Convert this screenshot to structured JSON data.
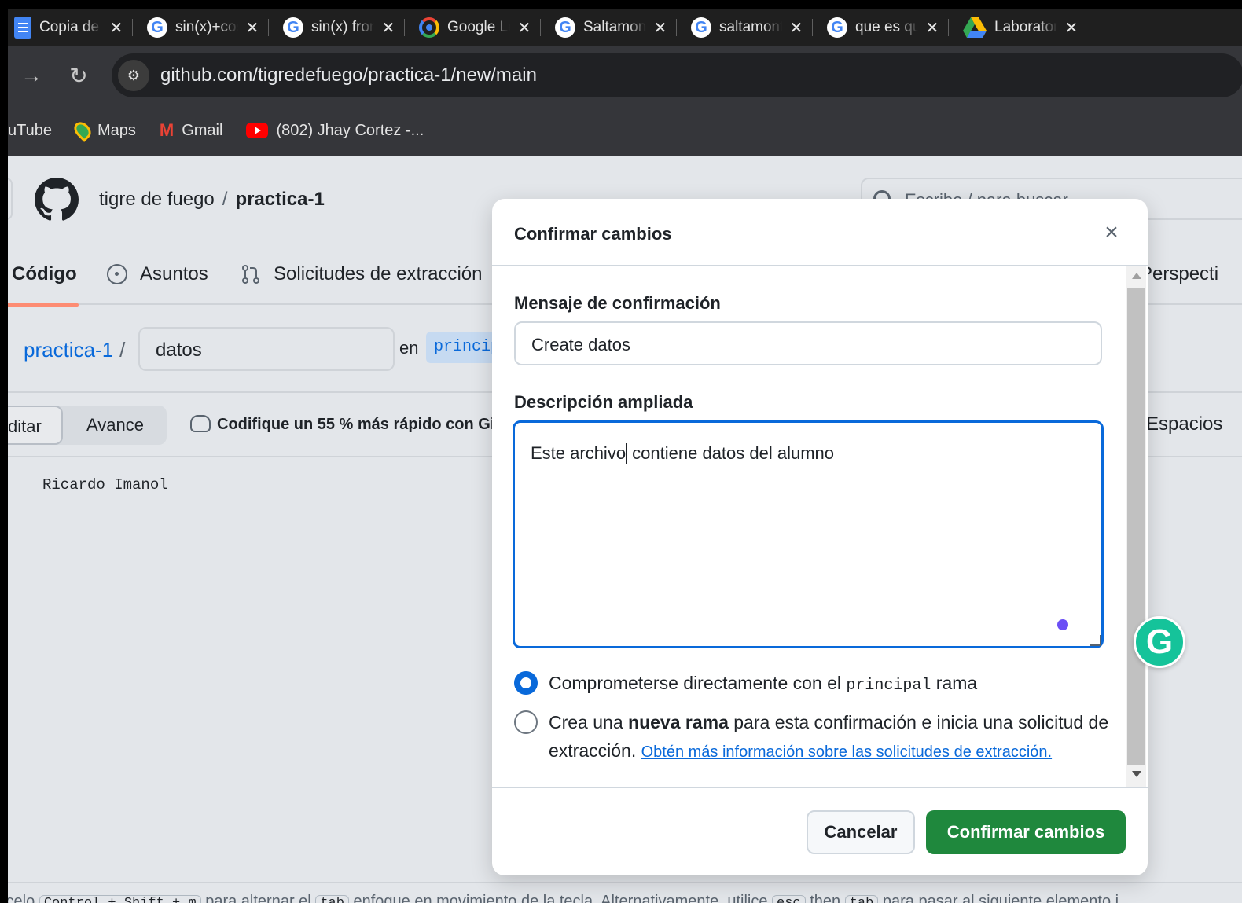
{
  "browser": {
    "tabs": [
      {
        "title": "Copia de",
        "icon": "docs-icon"
      },
      {
        "title": "sin(x)+cos",
        "icon": "google-icon"
      },
      {
        "title": "sin(x) from",
        "icon": "google-icon"
      },
      {
        "title": "Google Lens",
        "icon": "lens-icon"
      },
      {
        "title": "Saltamontes",
        "icon": "google-icon"
      },
      {
        "title": "saltamontes",
        "icon": "google-icon"
      },
      {
        "title": "que es que",
        "icon": "google-icon"
      },
      {
        "title": "Laboratorio",
        "icon": "drive-icon"
      }
    ],
    "tab_close": "✕",
    "url": "github.com/tigredefuego/practica-1/new/main",
    "bookmarks": [
      {
        "label": "uTube",
        "icon": "youtube-icon"
      },
      {
        "label": "Maps",
        "icon": "maps-icon"
      },
      {
        "label": "Gmail",
        "icon": "gmail-icon"
      },
      {
        "label": "(802) Jhay Cortez -...",
        "icon": "youtube-icon"
      }
    ]
  },
  "github": {
    "owner": "tigre de fuego",
    "repo": "practica-1",
    "search_placeholder": "Escribe / para buscar",
    "tabs": {
      "code": "Código",
      "issues": "Asuntos",
      "pulls": "Solicitudes de extracción",
      "insights": "Perspecti"
    },
    "repo_link": "practica-1",
    "path_sep": "/",
    "file_name": "datos",
    "branch_prefix": "en",
    "branch": "principal",
    "editor": {
      "edit": "ditar",
      "preview": "Avance",
      "copilot": "Codifique un 55 % más rápido con Gi",
      "spaces": "Espacios"
    },
    "code_line": "Ricardo Imanol",
    "hint": {
      "t1": "ícelo",
      "k1": "Control + Shift + m",
      "t2": "para alternar el",
      "k2": "tab",
      "t3": "enfoque en movimiento de la tecla. Alternativamente, utilice",
      "k3": "esc",
      "t4": "then",
      "k4": "tab",
      "t5": "para pasar al siguiente elemento i"
    }
  },
  "modal": {
    "title": "Confirmar cambios",
    "close": "×",
    "message_label": "Mensaje de confirmación",
    "message_value": "Create datos",
    "description_label": "Descripción ampliada",
    "description_before_caret": "Este archivo",
    "description_after_caret": " contiene datos del alumno",
    "option1": {
      "pre": "Comprometerse directamente con el ",
      "branch": "principal",
      "post": " rama",
      "selected": true
    },
    "option2": {
      "pre": "Crea una ",
      "bold": "nueva rama",
      "post": " para esta confirmación e inicia una solicitud de extracción. ",
      "link": "Obtén más información sobre las solicitudes de extracción.",
      "selected": false
    },
    "cancel": "Cancelar",
    "commit": "Confirmar cambios"
  },
  "colors": {
    "primary_button": "#1f883d",
    "focus_blue": "#0969da",
    "tab_active_underline": "#fd8c73",
    "grammarly": "#15c39a"
  }
}
